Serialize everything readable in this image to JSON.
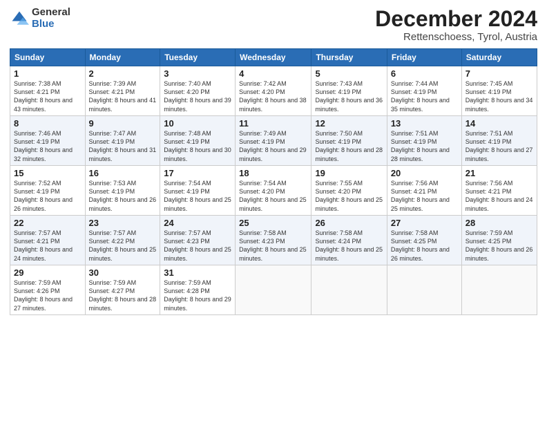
{
  "logo": {
    "general": "General",
    "blue": "Blue"
  },
  "header": {
    "month": "December 2024",
    "location": "Rettenschoess, Tyrol, Austria"
  },
  "days_of_week": [
    "Sunday",
    "Monday",
    "Tuesday",
    "Wednesday",
    "Thursday",
    "Friday",
    "Saturday"
  ],
  "weeks": [
    [
      {
        "day": "1",
        "sunrise": "Sunrise: 7:38 AM",
        "sunset": "Sunset: 4:21 PM",
        "daylight": "Daylight: 8 hours and 43 minutes."
      },
      {
        "day": "2",
        "sunrise": "Sunrise: 7:39 AM",
        "sunset": "Sunset: 4:21 PM",
        "daylight": "Daylight: 8 hours and 41 minutes."
      },
      {
        "day": "3",
        "sunrise": "Sunrise: 7:40 AM",
        "sunset": "Sunset: 4:20 PM",
        "daylight": "Daylight: 8 hours and 39 minutes."
      },
      {
        "day": "4",
        "sunrise": "Sunrise: 7:42 AM",
        "sunset": "Sunset: 4:20 PM",
        "daylight": "Daylight: 8 hours and 38 minutes."
      },
      {
        "day": "5",
        "sunrise": "Sunrise: 7:43 AM",
        "sunset": "Sunset: 4:19 PM",
        "daylight": "Daylight: 8 hours and 36 minutes."
      },
      {
        "day": "6",
        "sunrise": "Sunrise: 7:44 AM",
        "sunset": "Sunset: 4:19 PM",
        "daylight": "Daylight: 8 hours and 35 minutes."
      },
      {
        "day": "7",
        "sunrise": "Sunrise: 7:45 AM",
        "sunset": "Sunset: 4:19 PM",
        "daylight": "Daylight: 8 hours and 34 minutes."
      }
    ],
    [
      {
        "day": "8",
        "sunrise": "Sunrise: 7:46 AM",
        "sunset": "Sunset: 4:19 PM",
        "daylight": "Daylight: 8 hours and 32 minutes."
      },
      {
        "day": "9",
        "sunrise": "Sunrise: 7:47 AM",
        "sunset": "Sunset: 4:19 PM",
        "daylight": "Daylight: 8 hours and 31 minutes."
      },
      {
        "day": "10",
        "sunrise": "Sunrise: 7:48 AM",
        "sunset": "Sunset: 4:19 PM",
        "daylight": "Daylight: 8 hours and 30 minutes."
      },
      {
        "day": "11",
        "sunrise": "Sunrise: 7:49 AM",
        "sunset": "Sunset: 4:19 PM",
        "daylight": "Daylight: 8 hours and 29 minutes."
      },
      {
        "day": "12",
        "sunrise": "Sunrise: 7:50 AM",
        "sunset": "Sunset: 4:19 PM",
        "daylight": "Daylight: 8 hours and 28 minutes."
      },
      {
        "day": "13",
        "sunrise": "Sunrise: 7:51 AM",
        "sunset": "Sunset: 4:19 PM",
        "daylight": "Daylight: 8 hours and 28 minutes."
      },
      {
        "day": "14",
        "sunrise": "Sunrise: 7:51 AM",
        "sunset": "Sunset: 4:19 PM",
        "daylight": "Daylight: 8 hours and 27 minutes."
      }
    ],
    [
      {
        "day": "15",
        "sunrise": "Sunrise: 7:52 AM",
        "sunset": "Sunset: 4:19 PM",
        "daylight": "Daylight: 8 hours and 26 minutes."
      },
      {
        "day": "16",
        "sunrise": "Sunrise: 7:53 AM",
        "sunset": "Sunset: 4:19 PM",
        "daylight": "Daylight: 8 hours and 26 minutes."
      },
      {
        "day": "17",
        "sunrise": "Sunrise: 7:54 AM",
        "sunset": "Sunset: 4:19 PM",
        "daylight": "Daylight: 8 hours and 25 minutes."
      },
      {
        "day": "18",
        "sunrise": "Sunrise: 7:54 AM",
        "sunset": "Sunset: 4:20 PM",
        "daylight": "Daylight: 8 hours and 25 minutes."
      },
      {
        "day": "19",
        "sunrise": "Sunrise: 7:55 AM",
        "sunset": "Sunset: 4:20 PM",
        "daylight": "Daylight: 8 hours and 25 minutes."
      },
      {
        "day": "20",
        "sunrise": "Sunrise: 7:56 AM",
        "sunset": "Sunset: 4:21 PM",
        "daylight": "Daylight: 8 hours and 25 minutes."
      },
      {
        "day": "21",
        "sunrise": "Sunrise: 7:56 AM",
        "sunset": "Sunset: 4:21 PM",
        "daylight": "Daylight: 8 hours and 24 minutes."
      }
    ],
    [
      {
        "day": "22",
        "sunrise": "Sunrise: 7:57 AM",
        "sunset": "Sunset: 4:21 PM",
        "daylight": "Daylight: 8 hours and 24 minutes."
      },
      {
        "day": "23",
        "sunrise": "Sunrise: 7:57 AM",
        "sunset": "Sunset: 4:22 PM",
        "daylight": "Daylight: 8 hours and 25 minutes."
      },
      {
        "day": "24",
        "sunrise": "Sunrise: 7:57 AM",
        "sunset": "Sunset: 4:23 PM",
        "daylight": "Daylight: 8 hours and 25 minutes."
      },
      {
        "day": "25",
        "sunrise": "Sunrise: 7:58 AM",
        "sunset": "Sunset: 4:23 PM",
        "daylight": "Daylight: 8 hours and 25 minutes."
      },
      {
        "day": "26",
        "sunrise": "Sunrise: 7:58 AM",
        "sunset": "Sunset: 4:24 PM",
        "daylight": "Daylight: 8 hours and 25 minutes."
      },
      {
        "day": "27",
        "sunrise": "Sunrise: 7:58 AM",
        "sunset": "Sunset: 4:25 PM",
        "daylight": "Daylight: 8 hours and 26 minutes."
      },
      {
        "day": "28",
        "sunrise": "Sunrise: 7:59 AM",
        "sunset": "Sunset: 4:25 PM",
        "daylight": "Daylight: 8 hours and 26 minutes."
      }
    ],
    [
      {
        "day": "29",
        "sunrise": "Sunrise: 7:59 AM",
        "sunset": "Sunset: 4:26 PM",
        "daylight": "Daylight: 8 hours and 27 minutes."
      },
      {
        "day": "30",
        "sunrise": "Sunrise: 7:59 AM",
        "sunset": "Sunset: 4:27 PM",
        "daylight": "Daylight: 8 hours and 28 minutes."
      },
      {
        "day": "31",
        "sunrise": "Sunrise: 7:59 AM",
        "sunset": "Sunset: 4:28 PM",
        "daylight": "Daylight: 8 hours and 29 minutes."
      },
      {
        "day": "",
        "sunrise": "",
        "sunset": "",
        "daylight": ""
      },
      {
        "day": "",
        "sunrise": "",
        "sunset": "",
        "daylight": ""
      },
      {
        "day": "",
        "sunrise": "",
        "sunset": "",
        "daylight": ""
      },
      {
        "day": "",
        "sunrise": "",
        "sunset": "",
        "daylight": ""
      }
    ]
  ]
}
